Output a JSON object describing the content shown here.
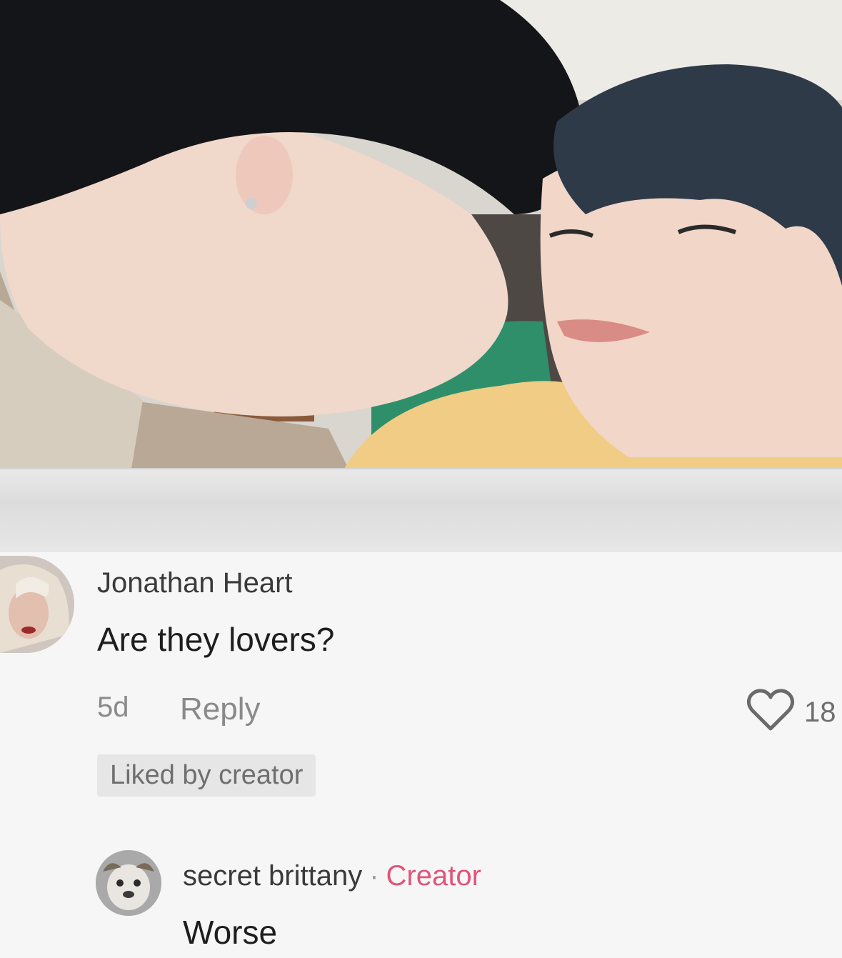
{
  "comment": {
    "username": "Jonathan Heart",
    "text": "Are they lovers?",
    "time": "5d",
    "reply_label": "Reply",
    "like_count": "18",
    "liked_badge": "Liked by creator"
  },
  "reply": {
    "username": "secret brittany",
    "separator": "·",
    "creator_label": "Creator",
    "text": "Worse"
  },
  "icons": {
    "like": "heart-outline-icon"
  },
  "colors": {
    "creator_accent": "#e0557a",
    "text_primary": "#1e1e1e",
    "text_secondary": "#8a8a8a"
  }
}
